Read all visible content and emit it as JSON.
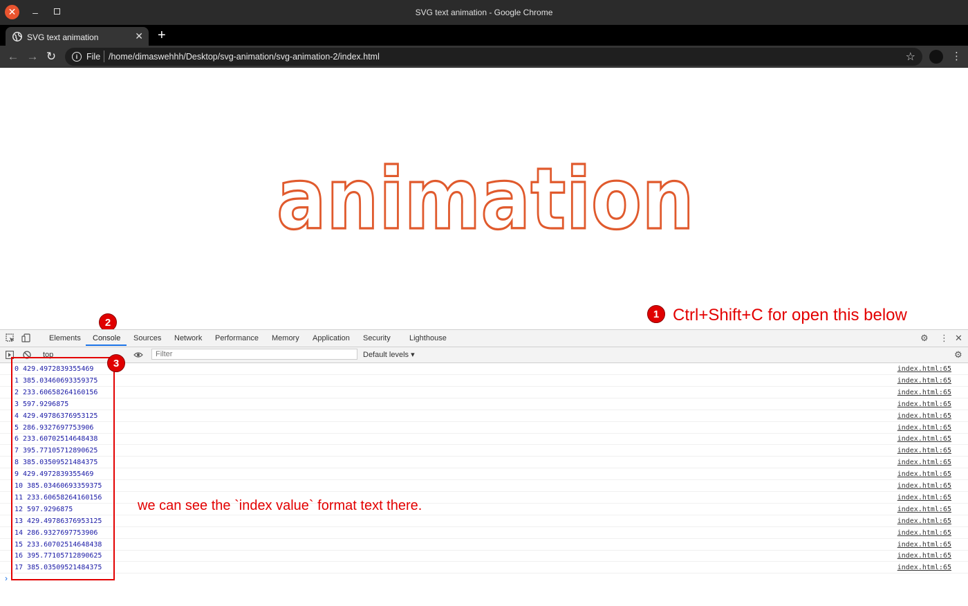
{
  "window": {
    "title": "SVG text animation - Google Chrome"
  },
  "tab": {
    "title": "SVG text animation",
    "close": "✕",
    "new_tab": "+"
  },
  "toolbar": {
    "scheme": "File",
    "url": "/home/dimaswehhh/Desktop/svg-animation/svg-animation-2/index.html"
  },
  "page": {
    "word": "animation",
    "stroke_color": "#e05a2d"
  },
  "annotations": {
    "badge_1": "1",
    "badge_2": "2",
    "badge_3": "3",
    "shortcut_note": "Ctrl+Shift+C for open this below",
    "log_note": "we can see the `index value` format text there.",
    "color": "#e30000"
  },
  "devtools": {
    "tabs": [
      "Elements",
      "Console",
      "Sources",
      "Network",
      "Performance",
      "Memory",
      "Application",
      "Security",
      "Lighthouse"
    ],
    "active_tab": "Console",
    "context": "top",
    "filter_placeholder": "Filter",
    "levels": "Default levels ▾"
  },
  "console": {
    "source": "index.html:65",
    "logs": [
      "0 429.4972839355469",
      "1 385.03460693359375",
      "2 233.60658264160156",
      "3 597.9296875",
      "4 429.49786376953125",
      "5 286.9327697753906",
      "6 233.60702514648438",
      "7 395.77105712890625",
      "8 385.03509521484375",
      "9 429.4972839355469",
      "10 385.03460693359375",
      "11 233.60658264160156",
      "12 597.9296875",
      "13 429.49786376953125",
      "14 286.9327697753906",
      "15 233.60702514648438",
      "16 395.77105712890625",
      "17 385.03509521484375"
    ]
  }
}
